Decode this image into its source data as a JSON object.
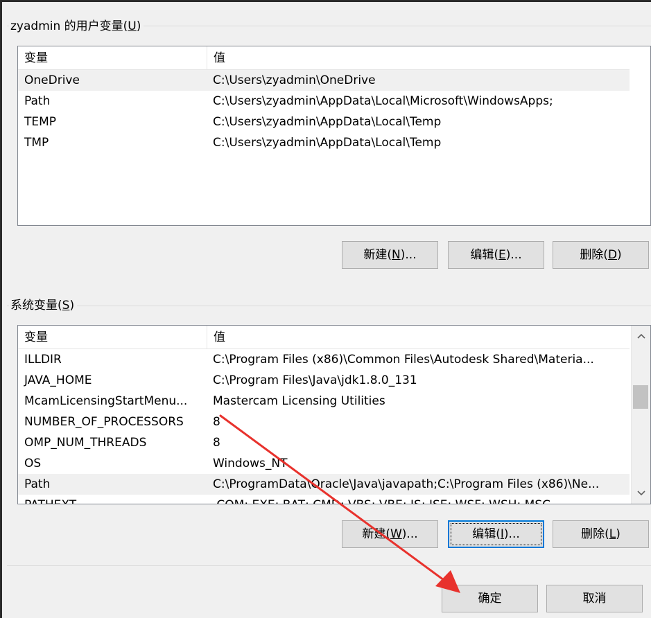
{
  "user_section": {
    "title": "zyadmin 的用户变量(",
    "access_key": "U",
    "title_end": ")",
    "columns": [
      "变量",
      "值"
    ],
    "rows": [
      {
        "name": "OneDrive",
        "value": "C:\\Users\\zyadmin\\OneDrive",
        "selected": true
      },
      {
        "name": "Path",
        "value": "C:\\Users\\zyadmin\\AppData\\Local\\Microsoft\\WindowsApps;",
        "selected": false
      },
      {
        "name": "TEMP",
        "value": "C:\\Users\\zyadmin\\AppData\\Local\\Temp",
        "selected": false
      },
      {
        "name": "TMP",
        "value": "C:\\Users\\zyadmin\\AppData\\Local\\Temp",
        "selected": false
      }
    ],
    "buttons": {
      "new": {
        "label": "新建(",
        "key": "N",
        "end": ")..."
      },
      "edit": {
        "label": "编辑(",
        "key": "E",
        "end": ")..."
      },
      "delete": {
        "label": "删除(",
        "key": "D",
        "end": ")"
      }
    }
  },
  "system_section": {
    "title": "系统变量(",
    "access_key": "S",
    "title_end": ")",
    "columns": [
      "变量",
      "值"
    ],
    "rows": [
      {
        "name": "ILLDIR",
        "value": "C:\\Program Files (x86)\\Common Files\\Autodesk Shared\\Materia...",
        "selected": false
      },
      {
        "name": "JAVA_HOME",
        "value": "C:\\Program Files\\Java\\jdk1.8.0_131",
        "selected": false
      },
      {
        "name": "McamLicensingStartMenu...",
        "value": "Mastercam Licensing Utilities",
        "selected": false
      },
      {
        "name": "NUMBER_OF_PROCESSORS",
        "value": "8",
        "selected": false
      },
      {
        "name": "OMP_NUM_THREADS",
        "value": "8",
        "selected": false
      },
      {
        "name": "OS",
        "value": "Windows_NT",
        "selected": false
      },
      {
        "name": "Path",
        "value": "C:\\ProgramData\\Oracle\\Java\\javapath;C:\\Program Files (x86)\\Ne...",
        "selected": true
      },
      {
        "name": "PATHEXT",
        "value": ".COM;.EXE;.BAT;.CMD;.VBS;.VBE;.JS;.JSE;.WSF;.WSH;.MSC",
        "selected": false
      }
    ],
    "buttons": {
      "new": {
        "label": "新建(",
        "key": "W",
        "end": ")..."
      },
      "edit": {
        "label": "编辑(",
        "key": "I",
        "end": ")..."
      },
      "delete": {
        "label": "删除(",
        "key": "L",
        "end": ")"
      }
    }
  },
  "dialog_buttons": {
    "ok": "确定",
    "cancel": "取消"
  },
  "colors": {
    "annotation_arrow": "#e8322d",
    "focus_border": "#0078d7",
    "selected_row": "#f0f0f0"
  },
  "icons": {
    "scroll_up": "chevron-up-icon",
    "scroll_down": "chevron-down-icon"
  }
}
